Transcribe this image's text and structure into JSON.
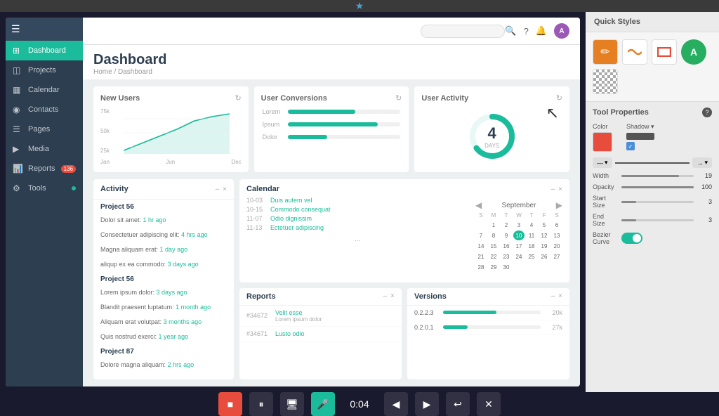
{
  "topBar": {
    "star": "★"
  },
  "sidebar": {
    "items": [
      {
        "label": "Dashboard",
        "icon": "⊞",
        "active": true
      },
      {
        "label": "Projects",
        "icon": "◫"
      },
      {
        "label": "Calendar",
        "icon": "▦"
      },
      {
        "label": "Contacts",
        "icon": "◉"
      },
      {
        "label": "Pages",
        "icon": "☰"
      },
      {
        "label": "Media",
        "icon": "▶"
      },
      {
        "label": "Reports",
        "icon": "📊",
        "badge": "136"
      },
      {
        "label": "Tools",
        "icon": "⚙",
        "dot": true
      }
    ]
  },
  "topNav": {
    "searchPlaceholder": "",
    "avatar": "A"
  },
  "page": {
    "title": "Dashboard",
    "breadcrumb": "Home / Dashboard"
  },
  "stats": {
    "newUsers": {
      "title": "New Users",
      "yLabels": [
        "75k",
        "50k",
        "25k"
      ],
      "xLabels": [
        "Jan",
        "Jun",
        "Dec"
      ]
    },
    "userConversions": {
      "title": "User Conversions",
      "bars": [
        {
          "label": "Lorem",
          "width": "60%"
        },
        {
          "label": "Ipsum",
          "width": "80%"
        },
        {
          "label": "Dolor",
          "width": "35%"
        }
      ]
    },
    "userActivity": {
      "title": "User Activity",
      "number": "4",
      "unit": "DAYS",
      "donutPercent": 65
    }
  },
  "activity": {
    "title": "Activity",
    "collapse": "–",
    "close": "×",
    "groups": [
      {
        "project": "Project 56",
        "items": [
          {
            "text": "Dolor sit amet:",
            "time": "1 hr ago"
          },
          {
            "text": "Consectetuer adipiscing elit:",
            "time": "4 hrs ago"
          },
          {
            "text": "Magna aliquam erat:",
            "time": "1 day ago"
          },
          {
            "text": "aliqup ex ea commodo:",
            "time": "3 days ago"
          }
        ]
      },
      {
        "project": "Project 56",
        "items": [
          {
            "text": "Lorem ipsum dolor:",
            "time": "3 days ago"
          },
          {
            "text": "Blandit praesent luptatum:",
            "time": "1 month ago"
          },
          {
            "text": "Aliquam erat volutpat:",
            "time": "3 months ago"
          },
          {
            "text": "Quis nostrud exerci:",
            "time": "1 year ago"
          }
        ]
      },
      {
        "project": "Project 87",
        "items": [
          {
            "text": "Dolore magna aliquam:",
            "time": "2 hrs ago"
          }
        ]
      }
    ]
  },
  "calendar": {
    "title": "Calendar",
    "month": "September",
    "events": [
      {
        "date": "10-03",
        "title": "Duis autem vel",
        "sub": ""
      },
      {
        "date": "10-15",
        "title": "Commodo consequat",
        "sub": ""
      },
      {
        "date": "11-07",
        "title": "Odio dignissim",
        "sub": ""
      },
      {
        "date": "11-13",
        "title": "Ectetuer adipiscing",
        "sub": ""
      }
    ],
    "dayHeaders": [
      "S",
      "M",
      "T",
      "W",
      "T",
      "F",
      "S"
    ],
    "weeks": [
      [
        "",
        "1",
        "2",
        "3",
        "4",
        "5",
        "6"
      ],
      [
        "7",
        "8",
        "9",
        "10",
        "11",
        "12",
        "13"
      ],
      [
        "14",
        "15",
        "16",
        "17",
        "18",
        "19",
        "20"
      ],
      [
        "21",
        "22",
        "23",
        "24",
        "25",
        "26",
        "27"
      ],
      [
        "28",
        "29",
        "30",
        "",
        "",
        "",
        ""
      ]
    ],
    "today": "10"
  },
  "reports": {
    "title": "Reports",
    "items": [
      {
        "id": "#34672",
        "title": "Velit esse",
        "sub": "Lorem ipsum dolor"
      },
      {
        "id": "#34671",
        "title": "Lusto odio",
        "sub": ""
      }
    ]
  },
  "versions": {
    "title": "Versions",
    "items": [
      {
        "version": "0.2.2.3",
        "width": "55%",
        "pct": "20k"
      },
      {
        "version": "0.2.0.1",
        "width": "25%",
        "pct": "27k"
      }
    ]
  },
  "quickStyles": {
    "title": "Quick Styles",
    "items": [
      "pencil",
      "wave",
      "rect",
      "avatar",
      "checker"
    ]
  },
  "toolProps": {
    "title": "Tool Properties",
    "helpIcon": "?",
    "colorLabel": "Color",
    "shadowLabel": "Shadow ▾",
    "widthLabel": "Width",
    "widthValue": "19",
    "opacityLabel": "Opacity",
    "opacityValue": "100",
    "startSizeLabel": "Start Size",
    "startSizeValue": "3",
    "endSizeLabel": "End Size",
    "endSizeValue": "3",
    "bezierLabel": "Bezier Curve"
  },
  "bottomBar": {
    "timer": "0:04"
  }
}
